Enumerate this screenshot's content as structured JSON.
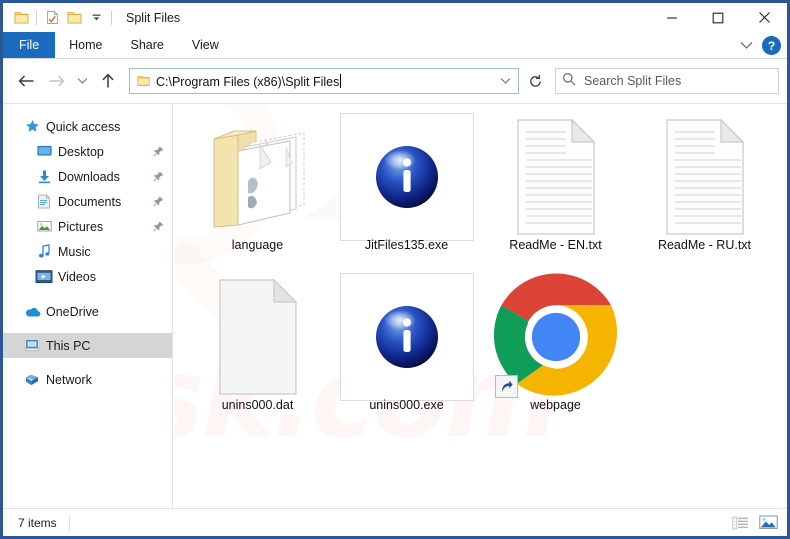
{
  "window": {
    "title": "Split Files",
    "quick_access_toolbar": [
      {
        "name": "folder-icon",
        "label": "Explorer"
      },
      {
        "name": "properties-icon",
        "label": "Properties"
      },
      {
        "name": "new-folder-icon",
        "label": "New folder"
      },
      {
        "name": "chevron-down-icon",
        "label": "Customize Quick Access Toolbar"
      }
    ],
    "controls": {
      "minimize": "–",
      "maximize": "□",
      "close": "✕",
      "help": "?"
    }
  },
  "ribbon": {
    "tabs": [
      {
        "label": "File",
        "active": true
      },
      {
        "label": "Home",
        "active": false
      },
      {
        "label": "Share",
        "active": false
      },
      {
        "label": "View",
        "active": false
      }
    ]
  },
  "address": {
    "back_icon": "back-arrow-icon",
    "forward_icon": "forward-arrow-icon",
    "recent_icon": "chevron-down-icon",
    "up_icon": "up-arrow-icon",
    "path": "C:\\Program Files (x86)\\Split Files",
    "dropdown_icon": "chevron-down-icon",
    "refresh_icon": "refresh-icon"
  },
  "search": {
    "icon": "search-icon",
    "placeholder": "Search Split Files",
    "value": ""
  },
  "sidebar": {
    "items": [
      {
        "label": "Quick access",
        "icon": "star-icon",
        "indent": 0,
        "pinned": false,
        "selected": false
      },
      {
        "label": "Desktop",
        "icon": "desktop-icon",
        "indent": 1,
        "pinned": true,
        "selected": false
      },
      {
        "label": "Downloads",
        "icon": "downloads-icon",
        "indent": 1,
        "pinned": true,
        "selected": false
      },
      {
        "label": "Documents",
        "icon": "documents-icon",
        "indent": 1,
        "pinned": true,
        "selected": false
      },
      {
        "label": "Pictures",
        "icon": "pictures-icon",
        "indent": 1,
        "pinned": true,
        "selected": false
      },
      {
        "label": "Music",
        "icon": "music-icon",
        "indent": 1,
        "pinned": false,
        "selected": false
      },
      {
        "label": "Videos",
        "icon": "videos-icon",
        "indent": 1,
        "pinned": false,
        "selected": false
      },
      {
        "label": "OneDrive",
        "icon": "onedrive-cloud-icon",
        "indent": 0,
        "pinned": false,
        "selected": false
      },
      {
        "label": "This PC",
        "icon": "this-pc-icon",
        "indent": 0,
        "pinned": false,
        "selected": true
      },
      {
        "label": "Network",
        "icon": "network-icon",
        "indent": 0,
        "pinned": false,
        "selected": false
      }
    ]
  },
  "files": [
    {
      "name": "language",
      "icon": "open-folder-icon",
      "framed": false,
      "shortcut": false
    },
    {
      "name": "JitFiles135.exe",
      "icon": "blue-info-orb-icon",
      "framed": true,
      "shortcut": false
    },
    {
      "name": "ReadMe - EN.txt",
      "icon": "text-file-icon",
      "framed": false,
      "shortcut": false
    },
    {
      "name": "ReadMe - RU.txt",
      "icon": "text-file-icon",
      "framed": false,
      "shortcut": false
    },
    {
      "name": "unins000.dat",
      "icon": "blank-file-icon",
      "framed": false,
      "shortcut": false
    },
    {
      "name": "unins000.exe",
      "icon": "blue-info-orb-icon",
      "framed": true,
      "shortcut": false
    },
    {
      "name": "webpage",
      "icon": "chrome-icon",
      "framed": false,
      "shortcut": true
    }
  ],
  "statusbar": {
    "item_count": "7 items",
    "views": [
      {
        "name": "details-view-button",
        "active": false
      },
      {
        "name": "large-icons-view-button",
        "active": true
      }
    ]
  },
  "watermark": {
    "text": "risk.com"
  },
  "colors": {
    "window_border": "#2b5797",
    "file_tab": "#1a6bbd",
    "selection": "#d5d5d5",
    "accent": "#1a6bbd"
  }
}
